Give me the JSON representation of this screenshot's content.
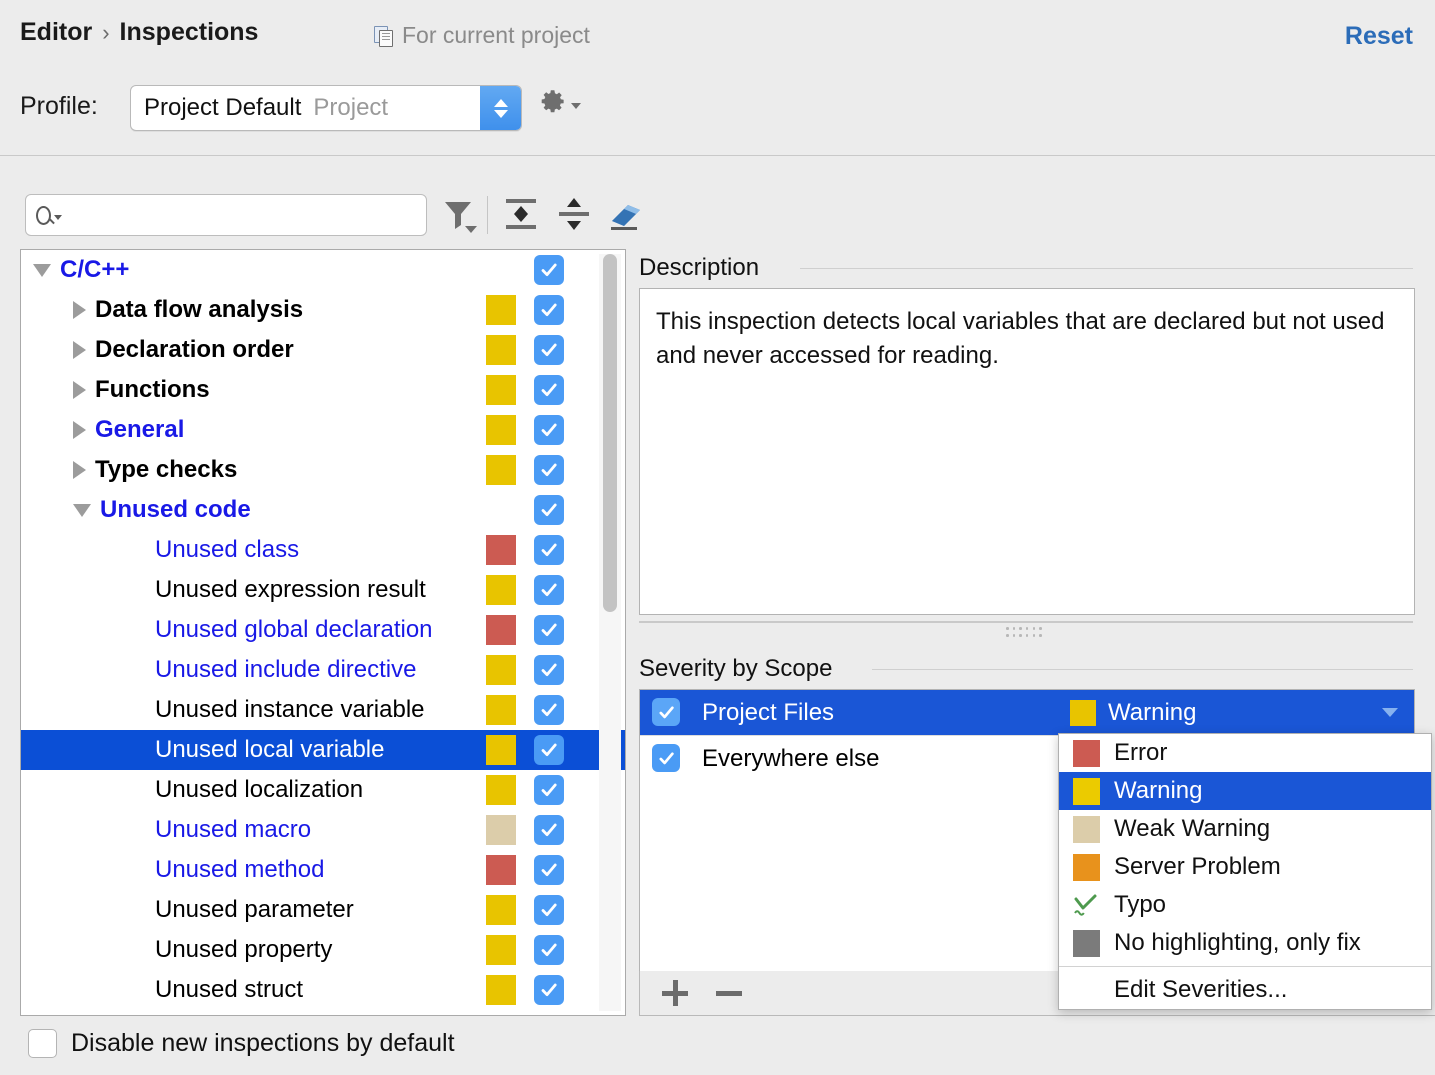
{
  "header": {
    "breadcrumb_root": "Editor",
    "breadcrumb_sep": "›",
    "breadcrumb_current": "Inspections",
    "scope_note": "For current project",
    "scope_note_icon": "copy-document-icon",
    "reset_label": "Reset"
  },
  "profile": {
    "label": "Profile:",
    "value": "Project Default",
    "suffix": "Project",
    "gear_icon": "gear-icon"
  },
  "toolbar": {
    "search_placeholder": "",
    "search_value": "",
    "search_icon": "search-icon",
    "filter_icon": "filter-funnel-icon",
    "expand_all_icon": "expand-all-icon",
    "collapse_all_icon": "collapse-all-icon",
    "reset_filter_icon": "eraser-icon"
  },
  "tree": {
    "rows": [
      {
        "label": "C/C++",
        "indent": 0,
        "twisty": "open",
        "bold": true,
        "blue": true,
        "severity": null,
        "checked": true,
        "selected": false
      },
      {
        "label": "Data flow analysis",
        "indent": 1,
        "twisty": "closed",
        "bold": true,
        "blue": false,
        "severity": "#E8C400",
        "checked": true,
        "selected": false
      },
      {
        "label": "Declaration order",
        "indent": 1,
        "twisty": "closed",
        "bold": true,
        "blue": false,
        "severity": "#E8C400",
        "checked": true,
        "selected": false
      },
      {
        "label": "Functions",
        "indent": 1,
        "twisty": "closed",
        "bold": true,
        "blue": false,
        "severity": "#E8C400",
        "checked": true,
        "selected": false
      },
      {
        "label": "General",
        "indent": 1,
        "twisty": "closed",
        "bold": true,
        "blue": true,
        "severity": "#E8C400",
        "checked": true,
        "selected": false
      },
      {
        "label": "Type checks",
        "indent": 1,
        "twisty": "closed",
        "bold": true,
        "blue": false,
        "severity": "#E8C400",
        "checked": true,
        "selected": false
      },
      {
        "label": "Unused code",
        "indent": 1,
        "twisty": "open",
        "bold": true,
        "blue": true,
        "severity": null,
        "checked": true,
        "selected": false
      },
      {
        "label": "Unused class",
        "indent": 2,
        "twisty": "none",
        "bold": false,
        "blue": true,
        "severity": "#CC5B52",
        "checked": true,
        "selected": false
      },
      {
        "label": "Unused expression result",
        "indent": 2,
        "twisty": "none",
        "bold": false,
        "blue": false,
        "severity": "#E8C400",
        "checked": true,
        "selected": false
      },
      {
        "label": "Unused global declaration",
        "indent": 2,
        "twisty": "none",
        "bold": false,
        "blue": true,
        "severity": "#CC5B52",
        "checked": true,
        "selected": false
      },
      {
        "label": "Unused include directive",
        "indent": 2,
        "twisty": "none",
        "bold": false,
        "blue": true,
        "severity": "#E8C400",
        "checked": true,
        "selected": false
      },
      {
        "label": "Unused instance variable",
        "indent": 2,
        "twisty": "none",
        "bold": false,
        "blue": false,
        "severity": "#E8C400",
        "checked": true,
        "selected": false
      },
      {
        "label": "Unused local variable",
        "indent": 2,
        "twisty": "none",
        "bold": false,
        "blue": false,
        "severity": "#E8C400",
        "checked": true,
        "selected": true
      },
      {
        "label": "Unused localization",
        "indent": 2,
        "twisty": "none",
        "bold": false,
        "blue": false,
        "severity": "#E8C400",
        "checked": true,
        "selected": false
      },
      {
        "label": "Unused macro",
        "indent": 2,
        "twisty": "none",
        "bold": false,
        "blue": true,
        "severity": "#DCCDAA",
        "checked": true,
        "selected": false
      },
      {
        "label": "Unused method",
        "indent": 2,
        "twisty": "none",
        "bold": false,
        "blue": true,
        "severity": "#CC5B52",
        "checked": true,
        "selected": false
      },
      {
        "label": "Unused parameter",
        "indent": 2,
        "twisty": "none",
        "bold": false,
        "blue": false,
        "severity": "#E8C400",
        "checked": true,
        "selected": false
      },
      {
        "label": "Unused property",
        "indent": 2,
        "twisty": "none",
        "bold": false,
        "blue": false,
        "severity": "#E8C400",
        "checked": true,
        "selected": false
      },
      {
        "label": "Unused struct",
        "indent": 2,
        "twisty": "none",
        "bold": false,
        "blue": false,
        "severity": "#E8C400",
        "checked": true,
        "selected": false
      },
      {
        "label": "",
        "indent": 2,
        "twisty": "none",
        "bold": false,
        "blue": false,
        "severity": "#E8C400",
        "checked": true,
        "selected": false
      }
    ]
  },
  "bottom": {
    "disable_new_label": "Disable new inspections by default",
    "disable_new_checked": false
  },
  "description": {
    "title": "Description",
    "body": "This inspection detects local variables that are declared but not used and never accessed for reading."
  },
  "severity_by_scope": {
    "title": "Severity by Scope",
    "rows": [
      {
        "scope": "Project Files",
        "checked": true,
        "severity": "Warning",
        "severity_color": "#E8C400",
        "selected": true
      },
      {
        "scope": "Everywhere else",
        "checked": true,
        "severity": "",
        "severity_color": "",
        "selected": false
      }
    ],
    "add_label": "+",
    "remove_label": "−"
  },
  "severity_menu": {
    "items": [
      {
        "label": "Error",
        "color": "#CC5B52",
        "selected": false,
        "icon": "color-swatch"
      },
      {
        "label": "Warning",
        "color": "#EBCB00",
        "selected": true,
        "icon": "color-swatch"
      },
      {
        "label": "Weak Warning",
        "color": "#DCCDAA",
        "selected": false,
        "icon": "color-swatch"
      },
      {
        "label": "Server Problem",
        "color": "#E8921C",
        "selected": false,
        "icon": "color-swatch"
      },
      {
        "label": "Typo",
        "color": "#4E9A4E",
        "selected": false,
        "icon": "typo-squiggle"
      },
      {
        "label": "No highlighting, only fix",
        "color": "#7B7B7B",
        "selected": false,
        "icon": "color-swatch"
      }
    ],
    "edit_label": "Edit Severities..."
  },
  "colors": {
    "accent_blue": "#2b6cb8",
    "selection_blue": "#0b4fd6",
    "checkbox_blue": "#4a9bf5",
    "warning": "#E8C400",
    "error": "#CC5B52",
    "weak_warning": "#DCCDAA",
    "link_blue": "#1919e6"
  }
}
